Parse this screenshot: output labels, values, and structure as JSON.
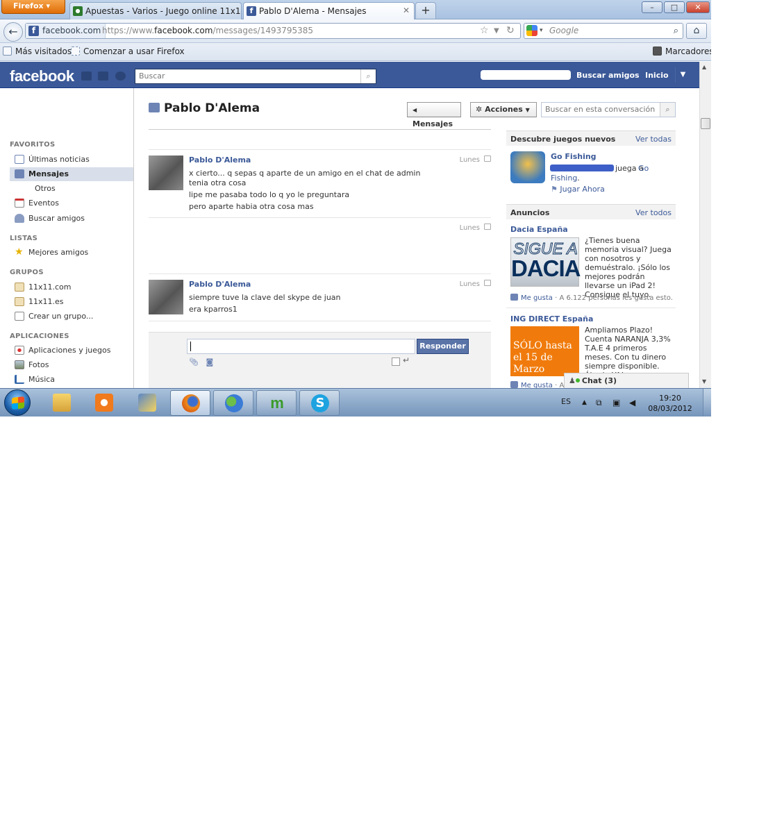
{
  "browser": {
    "menu_button": "Firefox",
    "tabs": [
      {
        "label": "Apuestas - Varios - Juego online 11x11",
        "active": false
      },
      {
        "label": "Pablo D'Alema - Mensajes",
        "active": true
      }
    ],
    "new_tab": "+",
    "window_controls": [
      "–",
      "□",
      "✕"
    ],
    "site_identity": "facebook.com",
    "url_prefix": "https://www.",
    "url_domain": "facebook.com",
    "url_path": "/messages/1493795385",
    "search_placeholder": "Google",
    "bookmarks": [
      "Más visitados",
      "Comenzar a usar Firefox"
    ],
    "bookmarks_menu": "Marcadores"
  },
  "facebook": {
    "logo": "facebook",
    "search_placeholder": "Buscar",
    "nav": {
      "find_friends": "Buscar amigos",
      "home": "Inicio"
    },
    "colors": {
      "brand": "#3b5998",
      "link": "#3b5998"
    }
  },
  "sidebar": {
    "favorites_header": "FAVORITOS",
    "favorites": [
      {
        "label": "Últimas noticias",
        "icon": "news-feed-icon"
      },
      {
        "label": "Mensajes",
        "icon": "messages-icon",
        "selected": true
      },
      {
        "label": "Otros",
        "icon": ""
      },
      {
        "label": "Eventos",
        "icon": "calendar-icon"
      },
      {
        "label": "Buscar amigos",
        "icon": "friends-icon"
      }
    ],
    "lists_header": "LISTAS",
    "lists": [
      {
        "label": "Mejores amigos",
        "icon": "star-icon"
      }
    ],
    "groups_header": "GRUPOS",
    "groups": [
      {
        "label": "11x11.com",
        "icon": "group-icon"
      },
      {
        "label": "11x11.es",
        "icon": "group-icon"
      },
      {
        "label": "Crear un grupo...",
        "icon": "create-group-icon"
      }
    ],
    "apps_header": "APLICACIONES",
    "apps": [
      {
        "label": "Aplicaciones y juegos",
        "icon": "apps-icon"
      },
      {
        "label": "Fotos",
        "icon": "photos-icon"
      },
      {
        "label": "Música",
        "icon": "music-icon"
      }
    ]
  },
  "conversation": {
    "title": "Pablo D'Alema",
    "back_button": "Mensajes",
    "actions_button": "Acciones",
    "search_placeholder": "Buscar en esta conversación",
    "messages": [
      {
        "author": "Pablo D'Alema",
        "time": "Lunes",
        "lines": [
          "x cierto... q sepas q aparte de un amigo en el chat de admin tenia otra cosa",
          "lipe me pasaba todo lo q yo le preguntara",
          "pero aparte habia otra cosa mas"
        ]
      },
      {
        "author": "",
        "time": "Lunes",
        "lines": []
      },
      {
        "author": "Pablo D'Alema",
        "time": "Lunes",
        "lines": [
          "siempre tuve la clave del skype de juan",
          "era kparros1"
        ]
      }
    ],
    "reply_button": "Responder",
    "enter_symbol": "↵"
  },
  "right": {
    "games_header": "Descubre juegos nuevos",
    "games_see_all": "Ver todas",
    "game_name": "Go Fishing",
    "game_text_suffix": "juega a",
    "game_link2": "Go",
    "game_link3": "Fishing",
    "game_play": "Jugar Ahora",
    "ads_header": "Anuncios",
    "ads_see_all": "Ver todos",
    "ad1": {
      "title": "Dacia España",
      "image_line1": "SIGUE A",
      "image_line2": "DACIA",
      "text": "¿Tienes buena memoria visual? Juega con nosotros y demuéstralo. ¡Sólo los mejores podrán llevarse un iPad 2! Consigue el tuyo.",
      "like": "Me gusta",
      "likes_text": "A 6.122 personas les gusta esto."
    },
    "ad2": {
      "title": "ING DIRECT España",
      "image_line1": "SÓLO hasta",
      "image_line2": "el 15 de Marzo",
      "text": "Ampliamos Plazo! Cuenta NARANJA 3,3% T.A.E 4 primeros meses. Con tu dinero siempre disponible. Ábrela YA!",
      "like": "Me gusta",
      "likes_text": "A"
    },
    "chat": "Chat (3)"
  },
  "taskbar": {
    "language": "ES",
    "time": "19:20",
    "date": "08/03/2012"
  }
}
